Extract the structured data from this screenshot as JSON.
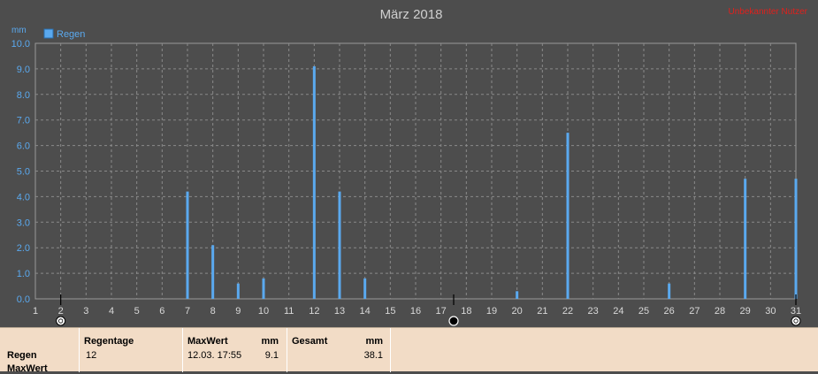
{
  "chart_data": {
    "type": "bar",
    "title": "März 2018",
    "ylabel": "mm",
    "xlabel": "",
    "legend": [
      {
        "name": "Regen",
        "color": "#5aa9ef"
      }
    ],
    "legend_position": "top-left",
    "grid": true,
    "ylim": [
      0.0,
      10.0
    ],
    "xlim": [
      1,
      31
    ],
    "yticks": [
      "0.0",
      "1.0",
      "2.0",
      "3.0",
      "4.0",
      "5.0",
      "6.0",
      "7.0",
      "8.0",
      "9.0",
      "10.0"
    ],
    "xticks": [
      1,
      2,
      3,
      4,
      5,
      6,
      7,
      8,
      9,
      10,
      11,
      12,
      13,
      14,
      15,
      16,
      17,
      18,
      19,
      20,
      21,
      22,
      23,
      24,
      25,
      26,
      27,
      28,
      29,
      30,
      31
    ],
    "series": [
      {
        "name": "Regen",
        "color": "#5aa9ef",
        "points": [
          {
            "x": 7,
            "y": 4.2
          },
          {
            "x": 8,
            "y": 2.1
          },
          {
            "x": 9,
            "y": 0.6
          },
          {
            "x": 10,
            "y": 0.8
          },
          {
            "x": 12,
            "y": 9.1
          },
          {
            "x": 13,
            "y": 4.2
          },
          {
            "x": 14,
            "y": 0.8
          },
          {
            "x": 20,
            "y": 0.3
          },
          {
            "x": 22,
            "y": 6.5
          },
          {
            "x": 26,
            "y": 0.6
          },
          {
            "x": 29,
            "y": 4.7
          },
          {
            "x": 31,
            "y": 4.7
          }
        ]
      }
    ]
  },
  "watermark": "Unbekannter Nutzer",
  "moon_phases": [
    {
      "day": 2,
      "icon": "full-moon-icon"
    },
    {
      "day": 17.5,
      "icon": "new-moon-icon"
    },
    {
      "day": 31,
      "icon": "full-moon-icon"
    }
  ],
  "summary": {
    "row_labels": [
      "Regen",
      "MaxWert"
    ],
    "regentage_header": "Regentage",
    "regentage_value": "12",
    "maxwert_header": "MaxWert",
    "maxwert_unit": "mm",
    "maxwert_time": "12.03.  17:55",
    "maxwert_value": "9.1",
    "gesamt_header": "Gesamt",
    "gesamt_unit": "mm",
    "gesamt_value": "38.1"
  },
  "colors": {
    "background": "#4d4d4d",
    "plot_border": "#999999",
    "grid": "#8a8a8a",
    "axis_text": "#5aa9ef",
    "bar": "#5aa9ef",
    "title": "#cfcfcf",
    "watermark": "#e0201c",
    "panel": "#f2dcc6"
  }
}
